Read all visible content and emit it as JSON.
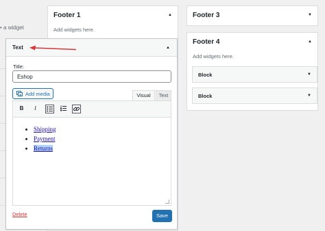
{
  "left_column": {
    "hint": "• a widget"
  },
  "footer1": {
    "title": "Footer 1",
    "description": "Add widgets here."
  },
  "footer3": {
    "title": "Footer 3"
  },
  "footer4": {
    "title": "Footer 4",
    "description": "Add widgets here.",
    "blocks": [
      {
        "label": "Block"
      },
      {
        "label": "Block"
      }
    ]
  },
  "text_widget": {
    "header": "Text",
    "title_label": "Title:",
    "title_value": "Eshop",
    "add_media_label": "Add media",
    "tabs": {
      "visual": "Visual",
      "text": "Text"
    },
    "toolbar": {
      "bold": "B",
      "italic": "I"
    },
    "links": [
      {
        "text": "Shipping"
      },
      {
        "text": "Payment"
      },
      {
        "text": "Returns",
        "selected": true
      }
    ],
    "delete_label": "Delete",
    "save_label": "Save"
  },
  "colors": {
    "accent": "#2271b1",
    "delete": "#d63638",
    "annotation_arrow": "#d63638"
  }
}
